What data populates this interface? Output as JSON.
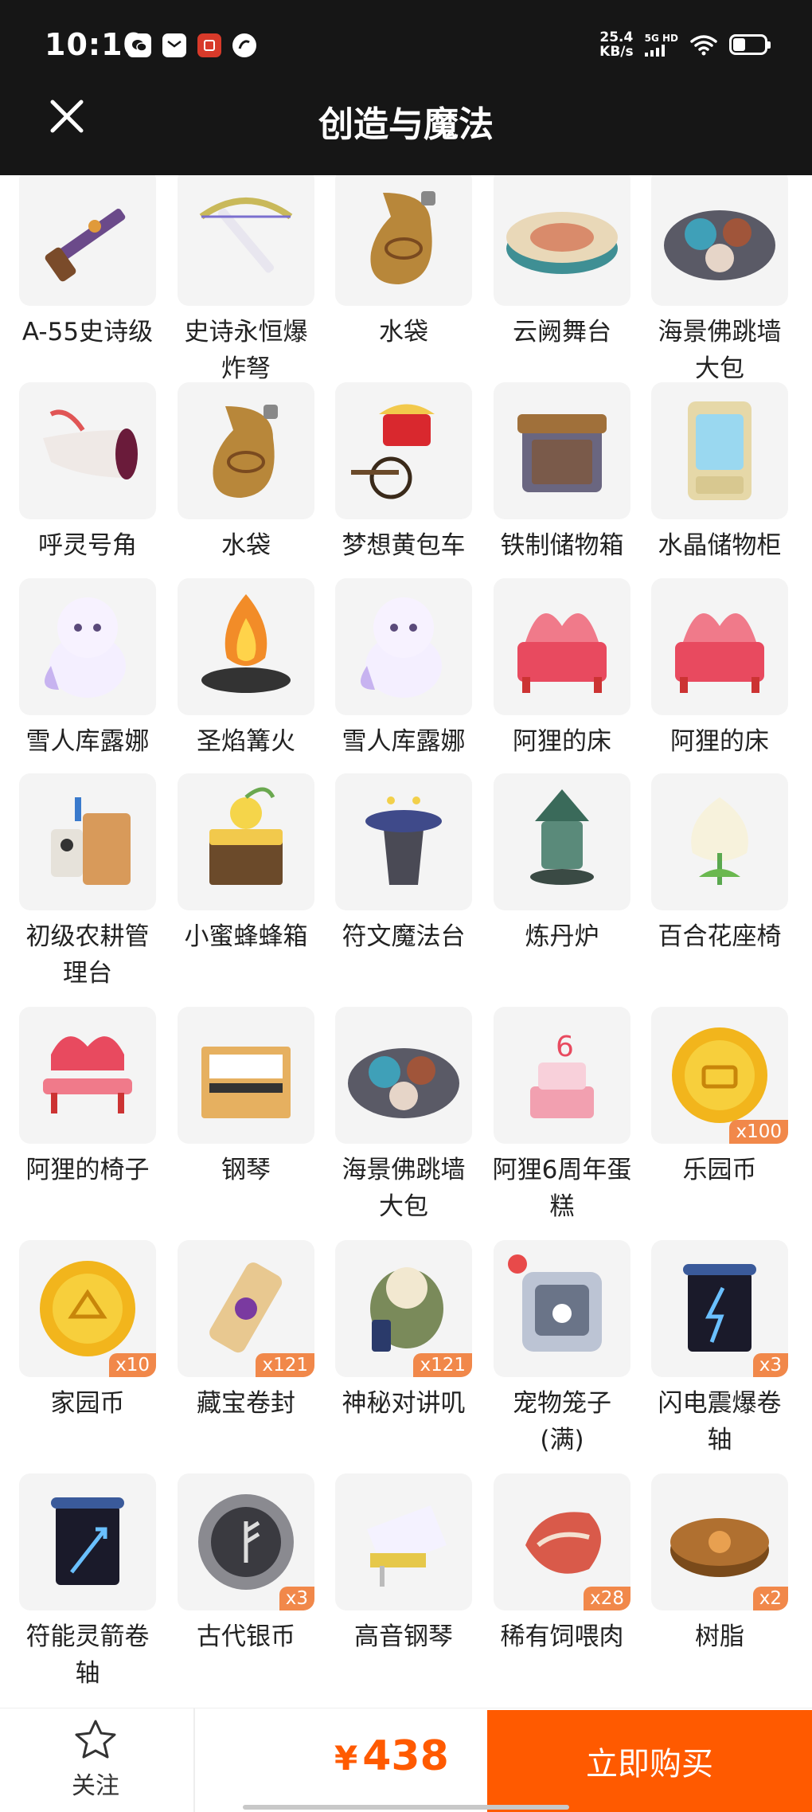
{
  "status_bar": {
    "time": "10:10",
    "speed_value": "25.4",
    "speed_unit": "KB/s",
    "network": "5G HD"
  },
  "header": {
    "title": "创造与魔法"
  },
  "items": [
    {
      "name": "A-55史诗级",
      "badge": "",
      "icon": "rifle-icon"
    },
    {
      "name": "史诗永恒爆炸弩",
      "badge": "",
      "icon": "crossbow-icon"
    },
    {
      "name": "水袋",
      "badge": "",
      "icon": "water-bag-icon"
    },
    {
      "name": "云阙舞台",
      "badge": "",
      "icon": "stage-icon"
    },
    {
      "name": "海景佛跳墙大包",
      "badge": "",
      "icon": "food-plate-icon"
    },
    {
      "name": "呼灵号角",
      "badge": "",
      "icon": "horn-icon"
    },
    {
      "name": "水袋",
      "badge": "",
      "icon": "water-bag-icon"
    },
    {
      "name": "梦想黄包车",
      "badge": "",
      "icon": "rickshaw-icon"
    },
    {
      "name": "铁制储物箱",
      "badge": "",
      "icon": "storage-box-icon"
    },
    {
      "name": "水晶储物柜",
      "badge": "",
      "icon": "crystal-cabinet-icon"
    },
    {
      "name": "雪人库露娜",
      "badge": "",
      "icon": "snowman-icon"
    },
    {
      "name": "圣焰篝火",
      "badge": "",
      "icon": "bonfire-icon"
    },
    {
      "name": "雪人库露娜",
      "badge": "",
      "icon": "snowman-icon"
    },
    {
      "name": "阿狸的床",
      "badge": "",
      "icon": "bed-icon"
    },
    {
      "name": "阿狸的床",
      "badge": "",
      "icon": "bed-icon"
    },
    {
      "name": "初级农耕管理台",
      "badge": "",
      "icon": "farm-console-icon"
    },
    {
      "name": "小蜜蜂蜂箱",
      "badge": "",
      "icon": "beehive-icon"
    },
    {
      "name": "符文魔法台",
      "badge": "",
      "icon": "rune-table-icon"
    },
    {
      "name": "炼丹炉",
      "badge": "",
      "icon": "furnace-icon"
    },
    {
      "name": "百合花座椅",
      "badge": "",
      "icon": "lily-seat-icon"
    },
    {
      "name": "阿狸的椅子",
      "badge": "",
      "icon": "bench-icon"
    },
    {
      "name": "钢琴",
      "badge": "",
      "icon": "piano-icon"
    },
    {
      "name": "海景佛跳墙大包",
      "badge": "",
      "icon": "food-plate-icon"
    },
    {
      "name": "阿狸6周年蛋糕",
      "badge": "",
      "icon": "cake-icon"
    },
    {
      "name": "乐园币",
      "badge": "x100",
      "icon": "gold-coin-icon"
    },
    {
      "name": "家园币",
      "badge": "x10",
      "icon": "home-coin-icon"
    },
    {
      "name": "藏宝卷封",
      "badge": "x121",
      "icon": "treasure-scroll-icon"
    },
    {
      "name": "神秘对讲叽",
      "badge": "x121",
      "icon": "walkie-bird-icon"
    },
    {
      "name": "宠物笼子(满)",
      "badge": "",
      "icon": "pet-cage-icon"
    },
    {
      "name": "闪电震爆卷轴",
      "badge": "x3",
      "icon": "lightning-scroll-icon"
    },
    {
      "name": "符能灵箭卷轴",
      "badge": "",
      "icon": "arrow-scroll-icon"
    },
    {
      "name": "古代银币",
      "badge": "x3",
      "icon": "silver-coin-icon"
    },
    {
      "name": "高音钢琴",
      "badge": "",
      "icon": "grand-piano-icon"
    },
    {
      "name": "稀有饲喂肉",
      "badge": "x28",
      "icon": "meat-icon"
    },
    {
      "name": "树脂",
      "badge": "x2",
      "icon": "resin-icon"
    }
  ],
  "bottom_bar": {
    "follow_label": "关注",
    "currency": "¥",
    "price": "438",
    "buy_label": "立即购买"
  }
}
